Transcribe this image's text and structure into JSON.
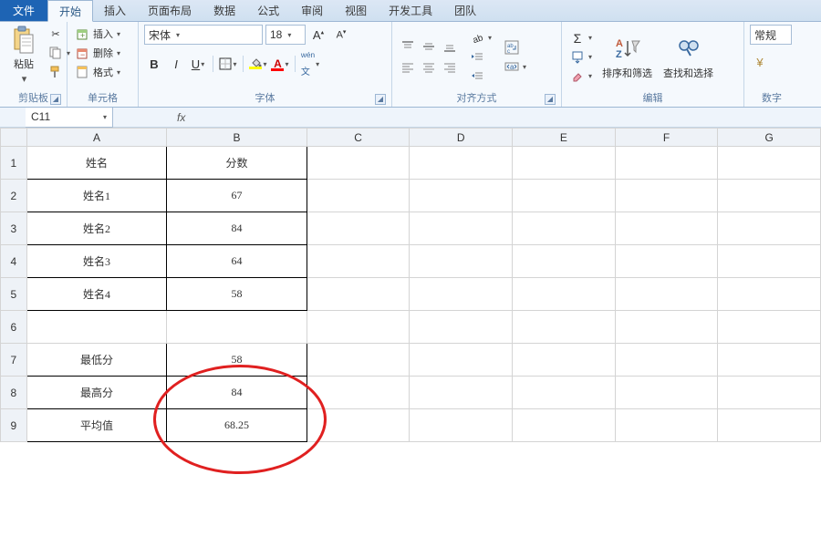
{
  "tabs": {
    "file": "文件",
    "items": [
      "开始",
      "插入",
      "页面布局",
      "数据",
      "公式",
      "审阅",
      "视图",
      "开发工具",
      "团队"
    ],
    "active": 0
  },
  "ribbon": {
    "clipboard": {
      "label": "剪贴板",
      "paste": "粘贴"
    },
    "cells": {
      "label": "单元格",
      "insert": "插入",
      "delete": "删除",
      "format": "格式"
    },
    "font": {
      "label": "字体",
      "name": "宋体",
      "size": "18",
      "bold": "B",
      "italic": "I",
      "underline": "U"
    },
    "align": {
      "label": "对齐方式"
    },
    "editing": {
      "label": "编辑",
      "sort": "排序和筛选",
      "find": "查找和选择"
    },
    "number": {
      "label": "数字",
      "general": "常规"
    }
  },
  "namebox": "C11",
  "formula": "",
  "columns": [
    "A",
    "B",
    "C",
    "D",
    "E",
    "F",
    "G"
  ],
  "rows": [
    1,
    2,
    3,
    4,
    5,
    6,
    7,
    8,
    9
  ],
  "cells": {
    "A1": "姓名",
    "B1": "分数",
    "A2": "姓名1",
    "B2": "67",
    "A3": "姓名2",
    "B3": "84",
    "A4": "姓名3",
    "B4": "64",
    "A5": "姓名4",
    "B5": "58",
    "A7": "最低分",
    "B7": "58",
    "A8": "最高分",
    "B8": "84",
    "A9": "平均值",
    "B9": "68.25"
  },
  "chart_data": {
    "type": "table",
    "title": "",
    "series": [
      {
        "name": "姓名1",
        "values": [
          67
        ]
      },
      {
        "name": "姓名2",
        "values": [
          84
        ]
      },
      {
        "name": "姓名3",
        "values": [
          64
        ]
      },
      {
        "name": "姓名4",
        "values": [
          58
        ]
      }
    ],
    "summary": {
      "最低分": 58,
      "最高分": 84,
      "平均值": 68.25
    }
  }
}
